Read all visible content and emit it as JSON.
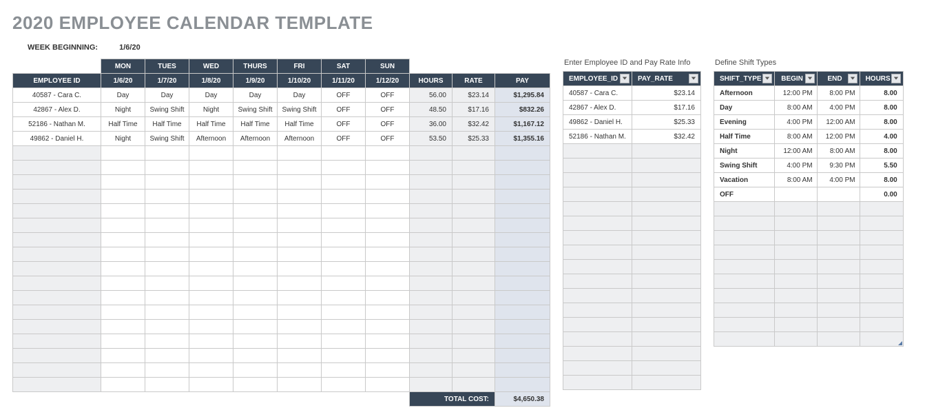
{
  "title": "2020 EMPLOYEE CALENDAR TEMPLATE",
  "week_beginning_label": "WEEK BEGINNING:",
  "week_beginning_value": "1/6/20",
  "main": {
    "day_headers": [
      "MON",
      "TUES",
      "WED",
      "THURS",
      "FRI",
      "SAT",
      "SUN"
    ],
    "date_headers": [
      "1/6/20",
      "1/7/20",
      "1/8/20",
      "1/9/20",
      "1/10/20",
      "1/11/20",
      "1/12/20"
    ],
    "emp_header": "EMPLOYEE ID",
    "hours_header": "HOURS",
    "rate_header": "RATE",
    "pay_header": "PAY",
    "rows": [
      {
        "emp": "40587 - Cara C.",
        "d": [
          "Day",
          "Day",
          "Day",
          "Day",
          "Day",
          "OFF",
          "OFF"
        ],
        "hours": "56.00",
        "rate": "$23.14",
        "pay": "$1,295.84"
      },
      {
        "emp": "42867 - Alex D.",
        "d": [
          "Night",
          "Swing Shift",
          "Night",
          "Swing Shift",
          "Swing Shift",
          "OFF",
          "OFF"
        ],
        "hours": "48.50",
        "rate": "$17.16",
        "pay": "$832.26"
      },
      {
        "emp": "52186 - Nathan M.",
        "d": [
          "Half Time",
          "Half Time",
          "Half Time",
          "Half Time",
          "Half Time",
          "OFF",
          "OFF"
        ],
        "hours": "36.00",
        "rate": "$32.42",
        "pay": "$1,167.12"
      },
      {
        "emp": "49862 - Daniel H.",
        "d": [
          "Night",
          "Swing Shift",
          "Afternoon",
          "Afternoon",
          "Afternoon",
          "OFF",
          "OFF"
        ],
        "hours": "53.50",
        "rate": "$25.33",
        "pay": "$1,355.16"
      }
    ],
    "empty_rows": 17,
    "total_label": "TOTAL COST:",
    "total_value": "$4,650.38"
  },
  "payrate": {
    "caption": "Enter Employee ID and Pay Rate Info",
    "headers": [
      "EMPLOYEE_ID",
      "PAY_RATE"
    ],
    "rows": [
      {
        "id": "40587 - Cara C.",
        "rate": "$23.14"
      },
      {
        "id": "42867 - Alex D.",
        "rate": "$17.16"
      },
      {
        "id": "49862 - Daniel H.",
        "rate": "$25.33"
      },
      {
        "id": "52186 - Nathan M.",
        "rate": "$32.42"
      }
    ],
    "empty_rows": 17
  },
  "shifts": {
    "caption": "Define Shift Types",
    "headers": [
      "SHIFT_TYPE",
      "BEGIN",
      "END",
      "HOURS"
    ],
    "rows": [
      {
        "name": "Afternoon",
        "begin": "12:00 PM",
        "end": "8:00 PM",
        "hours": "8.00"
      },
      {
        "name": "Day",
        "begin": "8:00 AM",
        "end": "4:00 PM",
        "hours": "8.00"
      },
      {
        "name": "Evening",
        "begin": "4:00 PM",
        "end": "12:00 AM",
        "hours": "8.00"
      },
      {
        "name": "Half Time",
        "begin": "8:00 AM",
        "end": "12:00 PM",
        "hours": "4.00"
      },
      {
        "name": "Night",
        "begin": "12:00 AM",
        "end": "8:00 AM",
        "hours": "8.00"
      },
      {
        "name": "Swing Shift",
        "begin": "4:00 PM",
        "end": "9:30 PM",
        "hours": "5.50"
      },
      {
        "name": "Vacation",
        "begin": "8:00 AM",
        "end": "4:00 PM",
        "hours": "8.00"
      },
      {
        "name": "OFF",
        "begin": "",
        "end": "",
        "hours": "0.00"
      }
    ],
    "empty_rows": 10
  }
}
